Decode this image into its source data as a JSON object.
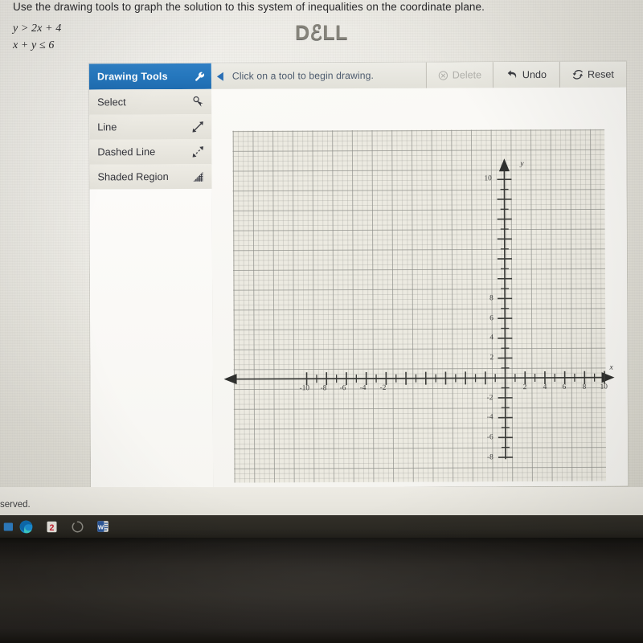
{
  "question": {
    "prompt": "Use the drawing tools to graph the solution to this system of inequalities on the coordinate plane.",
    "inequality_1": "y > 2x + 4",
    "inequality_2": "x + y ≤ 6"
  },
  "palette": {
    "title": "Drawing Tools",
    "header_icon": "wrench-icon",
    "tools": [
      {
        "label": "Select",
        "icon": "cursor-select-icon"
      },
      {
        "label": "Line",
        "icon": "double-arrow-line-icon"
      },
      {
        "label": "Dashed Line",
        "icon": "dashed-double-arrow-icon"
      },
      {
        "label": "Shaded Region",
        "icon": "hatched-triangle-icon"
      }
    ]
  },
  "toolbar": {
    "collapse_icon": "left-triangle-icon",
    "status": "Click on a tool to begin drawing.",
    "buttons": [
      {
        "label": "Delete",
        "icon": "circle-x-icon",
        "disabled": true
      },
      {
        "label": "Undo",
        "icon": "undo-arrow-icon",
        "disabled": false
      },
      {
        "label": "Reset",
        "icon": "refresh-icon",
        "disabled": false
      }
    ]
  },
  "graph": {
    "x_axis_name": "x",
    "y_axis_name": "y",
    "x_labels": [
      "-10",
      "-8",
      "-6",
      "-4",
      "-2",
      "2",
      "4",
      "6",
      "8",
      "10"
    ],
    "y_labels_positive": [
      "2",
      "4",
      "6",
      "8",
      "10"
    ],
    "y_labels_negative": [
      "-2",
      "-4",
      "-6",
      "-8"
    ]
  },
  "chart_data": {
    "type": "line",
    "title": "",
    "xlabel": "x",
    "ylabel": "y",
    "xlim": [
      -11,
      11
    ],
    "ylim": [
      -9.5,
      11
    ],
    "xticks": [
      -10,
      -8,
      -6,
      -4,
      -2,
      2,
      4,
      6,
      8,
      10
    ],
    "yticks": [
      -8,
      -6,
      -4,
      -2,
      2,
      4,
      6,
      8,
      10
    ],
    "minor_tick_step": 1,
    "grid": true,
    "grid_major_step": 2,
    "grid_minor_step": 0.5,
    "legend": "none",
    "series": [],
    "annotations": [
      "empty coordinate plane - no graph drawn yet"
    ]
  },
  "footer": {
    "copyright": "served."
  },
  "taskbar": {
    "items": [
      {
        "name": "pinned-app-icon",
        "glyph": ""
      },
      {
        "name": "edge-browser-icon",
        "glyph": ""
      },
      {
        "name": "acrobat-icon",
        "glyph": "2"
      },
      {
        "name": "loading-spinner-icon",
        "glyph": ""
      },
      {
        "name": "word-icon",
        "glyph": "W"
      }
    ]
  },
  "device": {
    "brand": "DℰLL"
  },
  "colors": {
    "header_blue": "#2577bd",
    "status_text": "#4d5b6e",
    "grid_line": "#9a9a95",
    "axis": "#3a3b38",
    "taskbar": "#2b2923",
    "bezel": "#2e2b26"
  }
}
